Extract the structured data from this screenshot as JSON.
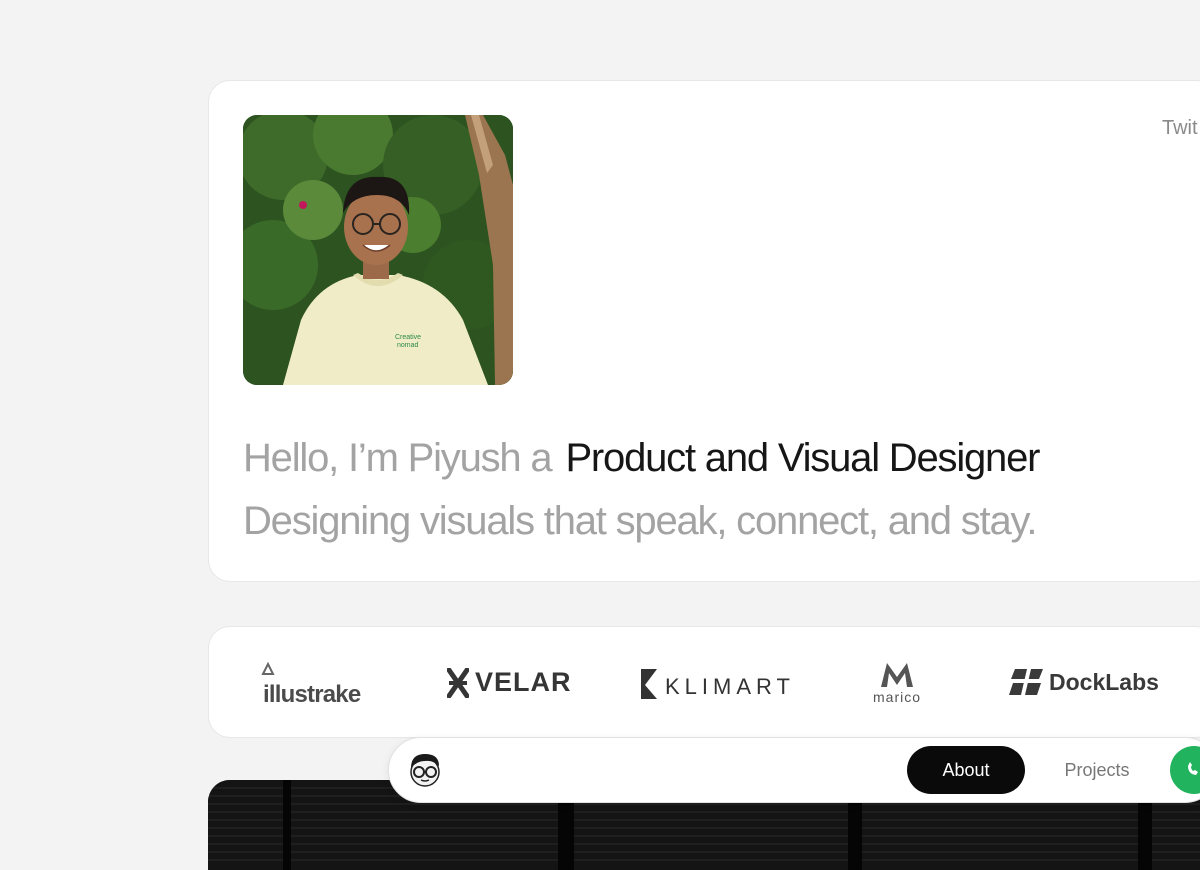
{
  "hero": {
    "social_label": "Twit",
    "greeting": "Hello, I’m Piyush a",
    "role": "Product and Visual Designer",
    "tagline": "Designing visuals that speak, connect, and stay.",
    "shirt_text_line1": "Creative",
    "shirt_text_line2": "nomad"
  },
  "clients": {
    "logos": [
      {
        "name": "illustrake",
        "text": "illustrake",
        "icon": "triangle-logo-icon"
      },
      {
        "name": "velar",
        "text": "VELAR",
        "icon": "velar-logo-icon"
      },
      {
        "name": "klimart",
        "text": "KLIMART",
        "icon": "klimart-logo-icon"
      },
      {
        "name": "marico",
        "text": "marico",
        "icon": "marico-logo-icon"
      },
      {
        "name": "docklabs",
        "text": "DockLabs",
        "icon": "docklabs-logo-icon"
      }
    ]
  },
  "nav": {
    "about_label": "About",
    "projects_label": "Projects",
    "contact_icon": "whatsapp-icon"
  },
  "colors": {
    "background": "#f3f3f3",
    "card": "#ffffff",
    "accent_green": "#22b35e",
    "active_pill": "#0a0a0a"
  }
}
